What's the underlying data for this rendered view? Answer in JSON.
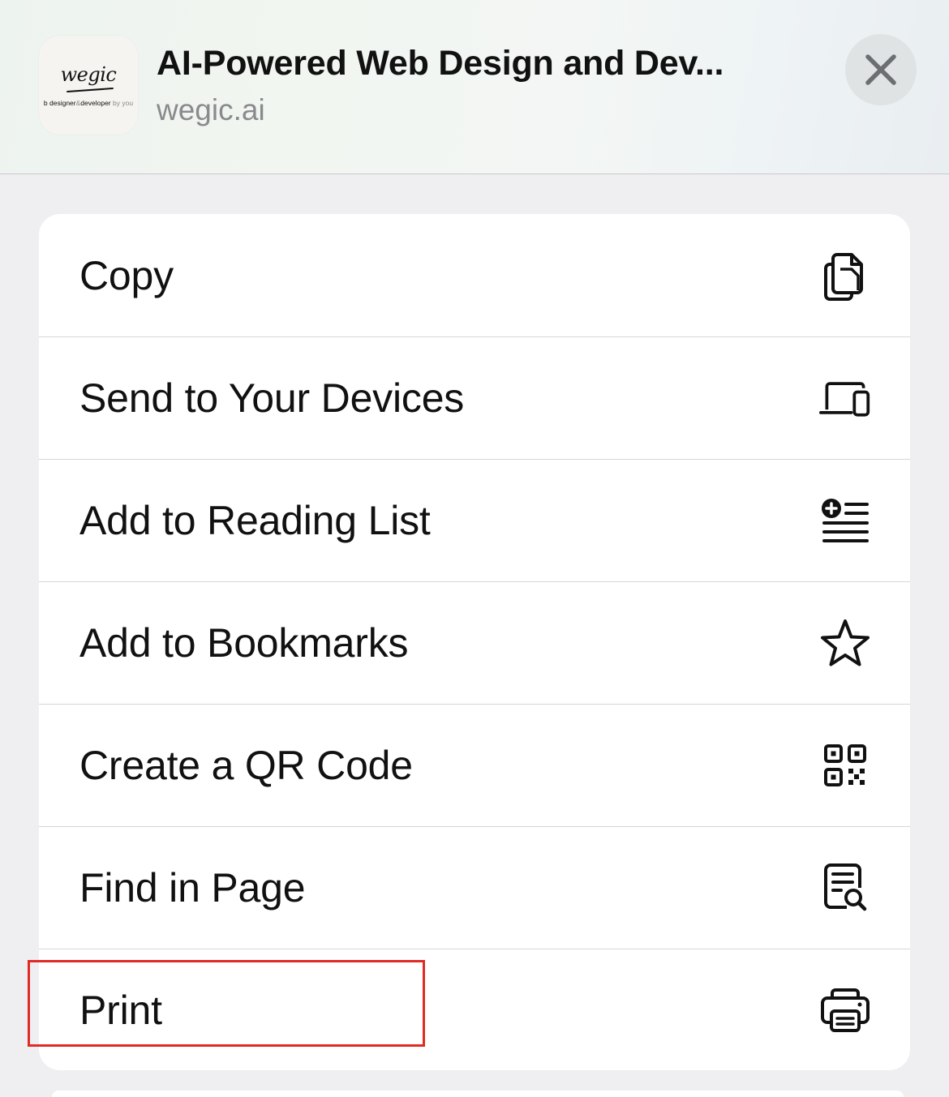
{
  "header": {
    "title": "AI-Powered Web Design and Dev...",
    "subtitle": "wegic.ai",
    "app_icon": {
      "logo_text": "wegic",
      "tagline_main": "b designer",
      "tagline_amp": "&",
      "tagline_dev": "developer",
      "tagline_by": "by you"
    },
    "close_icon": "close-icon"
  },
  "menu": {
    "items": [
      {
        "label": "Copy",
        "icon": "copy-icon"
      },
      {
        "label": "Send to Your Devices",
        "icon": "devices-icon"
      },
      {
        "label": "Add to Reading List",
        "icon": "reading-list-icon"
      },
      {
        "label": "Add to Bookmarks",
        "icon": "star-icon"
      },
      {
        "label": "Create a QR Code",
        "icon": "qr-code-icon"
      },
      {
        "label": "Find in Page",
        "icon": "find-in-page-icon"
      },
      {
        "label": "Print",
        "icon": "printer-icon"
      }
    ]
  },
  "annotation": {
    "highlight_color": "#e02b24",
    "highlighted_item": "Print"
  }
}
